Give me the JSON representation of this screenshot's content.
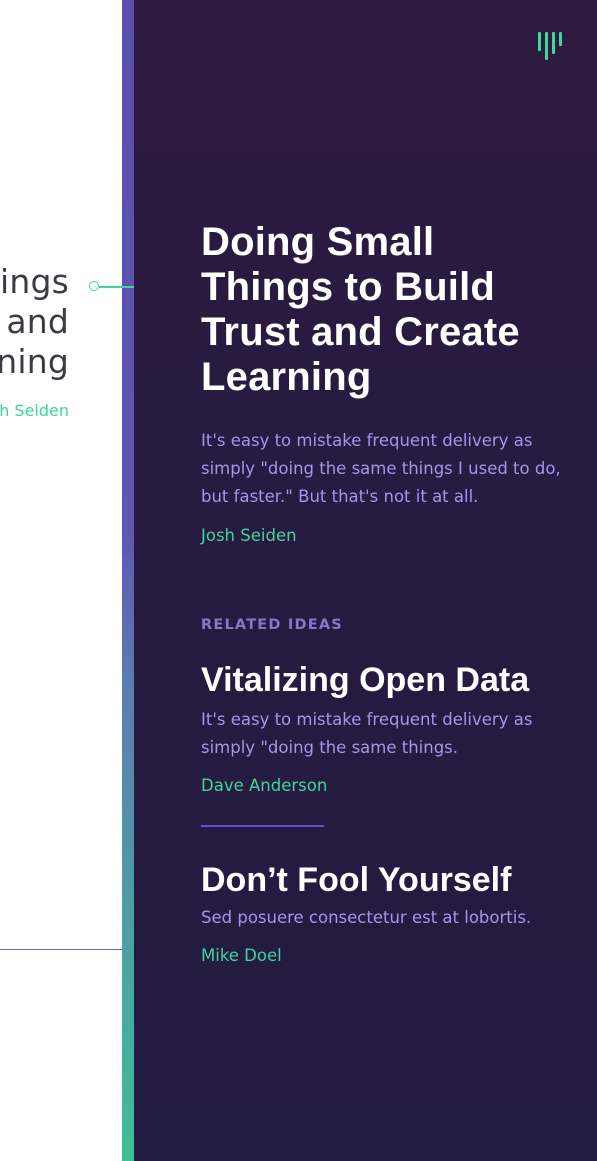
{
  "left_page": {
    "title_lines": [
      "ings",
      "and",
      "ning"
    ],
    "author": "h Seiden"
  },
  "article": {
    "title": "Doing Small Things to Build Trust and Create Learning",
    "description": "It's easy to mistake frequent delivery as simply \"doing the same things I used to do, but faster.\" But that's not it at all.",
    "author": "Josh Seiden"
  },
  "related": {
    "heading": "RELATED IDEAS",
    "items": [
      {
        "title": "Vitalizing Open Data",
        "description": "It's easy to mistake frequent delivery as simply \"doing the same things.",
        "author": "Dave Anderson"
      },
      {
        "title": "Don’t Fool Yourself",
        "description": "Sed posuere consectetur est at lobortis.",
        "author": "Mike Doel"
      }
    ]
  },
  "colors": {
    "panel_bg": "#2a1a40",
    "accent_green": "#3fd69a",
    "text_lavender": "#a894e8",
    "heading_muted": "#8877c6"
  },
  "icons": {
    "logo": "brand-bars-logo-icon",
    "connector": "timeline-dot-icon"
  }
}
